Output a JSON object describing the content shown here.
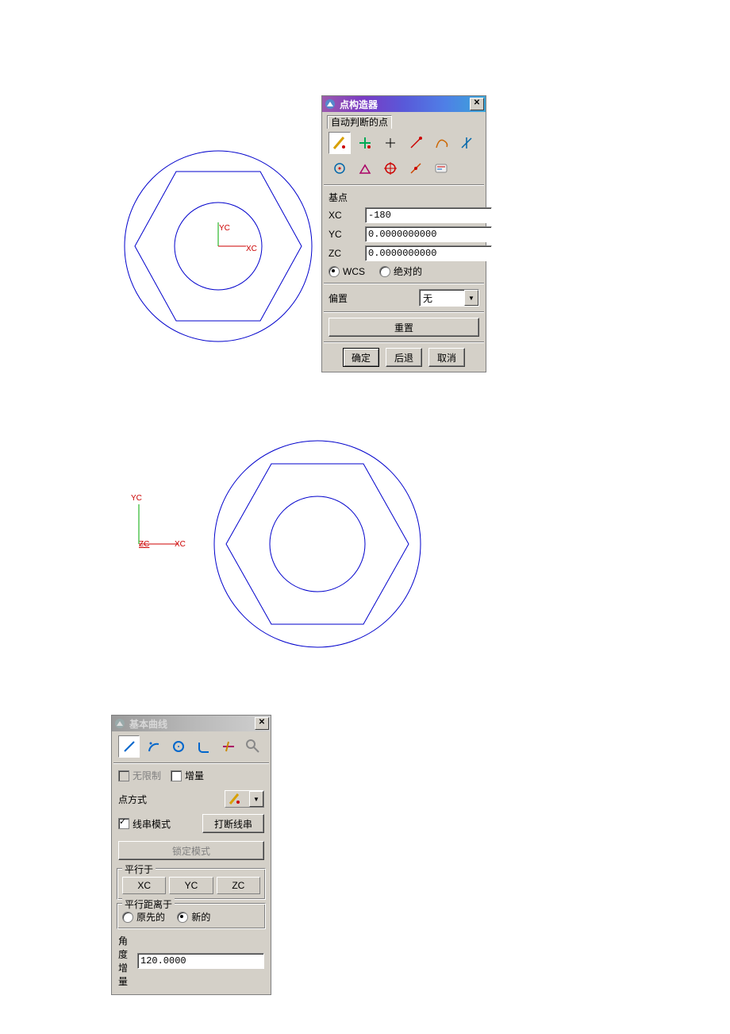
{
  "panel1": {
    "title": "点构造器",
    "section_auto": "自动判断的点",
    "base_point_label": "基点",
    "xc_label": "XC",
    "yc_label": "YC",
    "zc_label": "ZC",
    "xc_value": "-180",
    "yc_value": "0.0000000000",
    "zc_value": "0.0000000000",
    "wcs_label": "WCS",
    "abs_label": "绝对的",
    "offset_label": "偏置",
    "offset_value": "无",
    "reset_label": "重置",
    "ok_label": "确定",
    "back_label": "后退",
    "cancel_label": "取消"
  },
  "panel2": {
    "title": "基本曲线",
    "unlimited_label": "无限制",
    "increment_label": "增量",
    "point_method_label": "点方式",
    "string_mode_label": "线串模式",
    "break_string_label": "打断线串",
    "lock_mode_label": "锁定模式",
    "parallel_to_label": "平行于",
    "xc_label": "XC",
    "yc_label": "YC",
    "zc_label": "ZC",
    "parallel_dist_label": "平行距离于",
    "prev_label": "原先的",
    "new_label": "新的",
    "angle_inc_label": "角度增量",
    "angle_inc_value": "120.0000"
  },
  "axes": {
    "yc": "YC",
    "xc": "XC",
    "zc": "ZC"
  }
}
